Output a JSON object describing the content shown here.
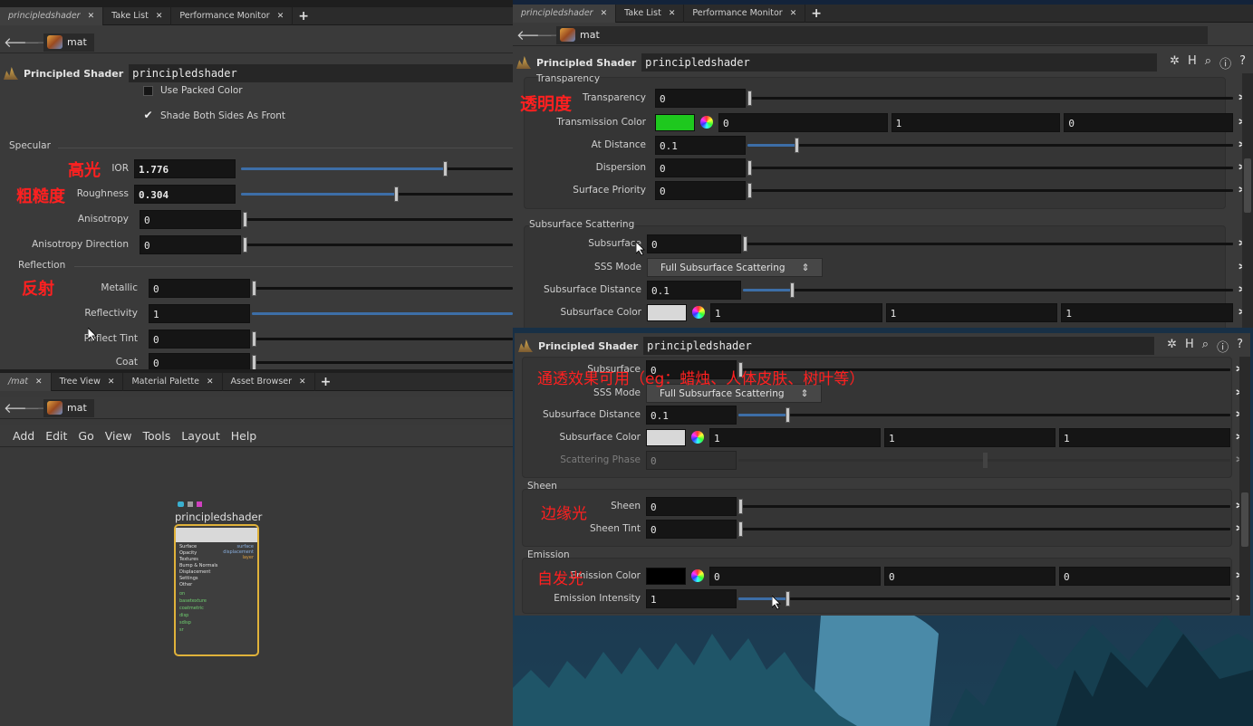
{
  "left": {
    "tabs": [
      "principledshader",
      "Take List",
      "Performance Monitor"
    ],
    "path": "mat",
    "header": {
      "type": "Principled Shader",
      "name": "principledshader"
    },
    "use_packed_color": "Use Packed Color",
    "shade_both_sides": "Shade Both Sides As Front",
    "check_mark": "✔",
    "specular_title": "Specular",
    "ior": {
      "label": "IOR",
      "value": "1.776",
      "fraction": 0.75
    },
    "roughness": {
      "label": "Roughness",
      "value": "0.304",
      "fraction": 0.57
    },
    "anisotropy": {
      "label": "Anisotropy",
      "value": "0"
    },
    "aniso_dir": {
      "label": "Anisotropy Direction",
      "value": "0"
    },
    "reflection_title": "Reflection",
    "metallic": {
      "label": "Metallic",
      "value": "0"
    },
    "reflectivity": {
      "label": "Reflectivity",
      "value": "1"
    },
    "reflect_tint": {
      "label": "Reflect Tint",
      "value": "0"
    },
    "coat": {
      "label": "Coat",
      "value": "0"
    },
    "cn_ior": "高光",
    "cn_roughness": "粗糙度",
    "cn_reflect": "反射"
  },
  "bottom_left": {
    "tabs": [
      "/mat",
      "Tree View",
      "Material Palette",
      "Asset Browser"
    ],
    "path": "mat",
    "menu": [
      "Add",
      "Edit",
      "Go",
      "View",
      "Tools",
      "Layout",
      "Help"
    ],
    "node_name": "principledshader",
    "node_inputs": [
      "Surface",
      "Opacity",
      "Textures",
      "Bump & Normals",
      "Displacement",
      "Settings",
      "Other",
      "on",
      "basetexture",
      "coatmetric",
      "disp",
      "sdisp",
      "sr"
    ],
    "node_outputs": [
      "surface",
      "displacement",
      "layer"
    ]
  },
  "top_right": {
    "tabs": [
      "principledshader",
      "Take List",
      "Performance Monitor"
    ],
    "path": "mat",
    "header": {
      "type": "Principled Shader",
      "name": "principledshader"
    },
    "transparency_title": "Transparency",
    "transparency": {
      "label": "Transparency",
      "value": "0"
    },
    "transmission_color": {
      "label": "Transmission Color",
      "values": [
        "0",
        "1",
        "0"
      ],
      "color": "#1ec81e"
    },
    "at_distance": {
      "label": "At Distance",
      "value": "0.1",
      "fraction": 0.1
    },
    "dispersion": {
      "label": "Dispersion",
      "value": "0"
    },
    "surface_priority": {
      "label": "Surface Priority",
      "value": "0"
    },
    "sss_title": "Subsurface Scattering",
    "subsurface": {
      "label": "Subsurface",
      "value": "0"
    },
    "sss_mode": {
      "label": "SSS Mode",
      "value": "Full Subsurface Scattering"
    },
    "sss_distance": {
      "label": "Subsurface Distance",
      "value": "0.1",
      "fraction": 0.1
    },
    "sss_color": {
      "label": "Subsurface Color",
      "values": [
        "1",
        "1",
        "1"
      ],
      "color": "#d8d8d8"
    },
    "cn_transparency": "透明度"
  },
  "lower_right": {
    "header": {
      "type": "Principled Shader",
      "name": "principledshader"
    },
    "subsurface": {
      "label": "Subsurface",
      "value": "0"
    },
    "sss_mode": {
      "label": "SSS Mode",
      "value": "Full Subsurface Scattering"
    },
    "sss_distance": {
      "label": "Subsurface Distance",
      "value": "0.1",
      "fraction": 0.1
    },
    "sss_color": {
      "label": "Subsurface Color",
      "values": [
        "1",
        "1",
        "1"
      ],
      "color": "#d8d8d8"
    },
    "scattering_phase": {
      "label": "Scattering Phase",
      "value": "0"
    },
    "sheen_title": "Sheen",
    "sheen": {
      "label": "Sheen",
      "value": "0"
    },
    "sheen_tint": {
      "label": "Sheen Tint",
      "value": "0"
    },
    "emission_title": "Emission",
    "emission_color": {
      "label": "Emission Color",
      "values": [
        "0",
        "0",
        "0"
      ],
      "color": "#000000"
    },
    "emission_intensity": {
      "label": "Emission Intensity",
      "value": "1",
      "fraction": 0.1
    },
    "cn_sss": "通透效果可用（eg：蜡烛、人体皮肤、树叶等）",
    "cn_sheen": "边缘光",
    "cn_emission": "自发光"
  },
  "icons": {
    "gear": "gear-icon",
    "help": "help-icon",
    "info": "info-icon",
    "search": "search-icon"
  }
}
